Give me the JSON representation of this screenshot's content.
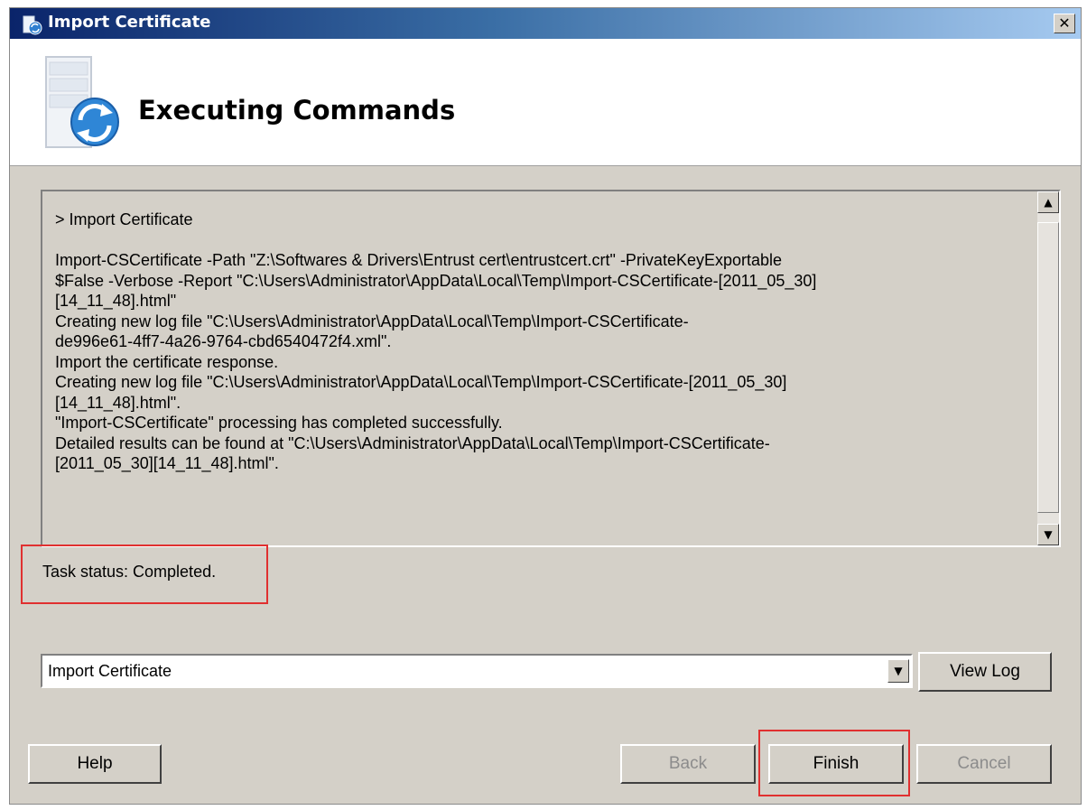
{
  "window": {
    "title": "Import Certificate",
    "close_label": "✕"
  },
  "header": {
    "title": "Executing Commands"
  },
  "output": {
    "lines": [
      "> Import Certificate",
      "",
      "Import-CSCertificate -Path \"Z:\\Softwares & Drivers\\Entrust cert\\entrustcert.crt\" -PrivateKeyExportable",
      "$False -Verbose -Report \"C:\\Users\\Administrator\\AppData\\Local\\Temp\\Import-CSCertificate-[2011_05_30]",
      "[14_11_48].html\"",
      "Creating new log file \"C:\\Users\\Administrator\\AppData\\Local\\Temp\\Import-CSCertificate-",
      "de996e61-4ff7-4a26-9764-cbd6540472f4.xml\".",
      "Import the certificate response.",
      "Creating new log file \"C:\\Users\\Administrator\\AppData\\Local\\Temp\\Import-CSCertificate-[2011_05_30]",
      "[14_11_48].html\".",
      "\"Import-CSCertificate\" processing has completed successfully.",
      "Detailed results can be found at \"C:\\Users\\Administrator\\AppData\\Local\\Temp\\Import-CSCertificate-",
      "[2011_05_30][14_11_48].html\"."
    ]
  },
  "status": {
    "text": "Task status: Completed."
  },
  "task_select": {
    "selected": "Import Certificate"
  },
  "buttons": {
    "view_log": "View Log",
    "help": "Help",
    "back": "Back",
    "finish": "Finish",
    "cancel": "Cancel"
  },
  "colors": {
    "highlight": "#e03030",
    "title_bar": "#0a246a",
    "dialog_bg": "#d4d0c8"
  }
}
